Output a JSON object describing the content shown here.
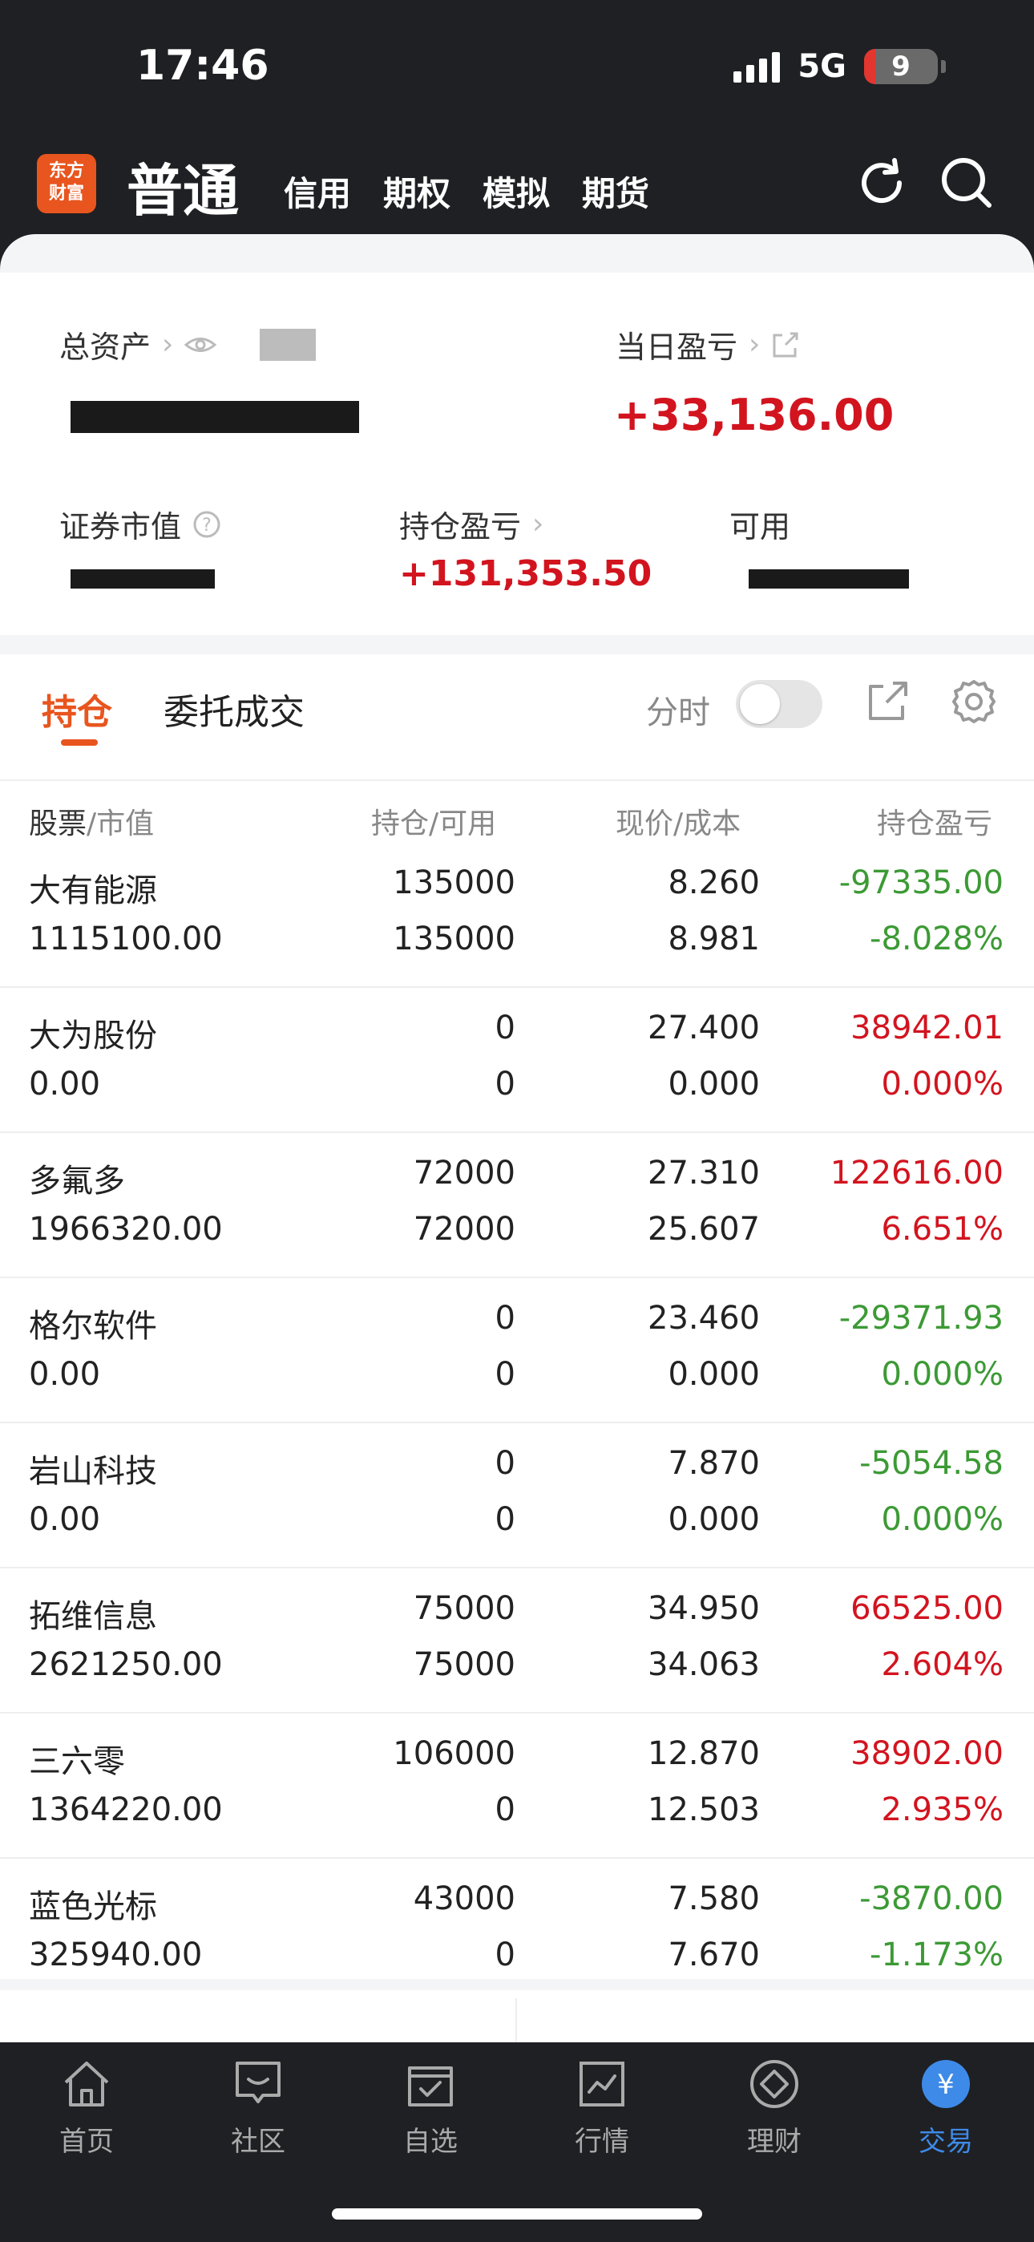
{
  "status": {
    "time": "17:46",
    "network": "5G",
    "battery": "9"
  },
  "header": {
    "logo_line1": "东方",
    "logo_line2": "财富",
    "main_tab": "普通",
    "tabs": [
      "信用",
      "期权",
      "模拟",
      "期货"
    ]
  },
  "summary": {
    "total_assets_label": "总资产",
    "daily_pl_label": "当日盈亏",
    "daily_pl_value": "+33,136.00",
    "market_value_label": "证券市值",
    "position_pl_label": "持仓盈亏",
    "position_pl_value": "+131,353.50",
    "available_label": "可用"
  },
  "positions": {
    "tab_active": "持仓",
    "tab_other": "委托成交",
    "fenshi_label": "分时",
    "columns": {
      "stock": "股票",
      "market_value": "/市值",
      "position": "持仓",
      "available": "/可用",
      "price": "现价",
      "cost": "/成本",
      "pl": "持仓盈亏"
    },
    "rows": [
      {
        "name": "大有能源",
        "value": "1115100.00",
        "position": "135000",
        "available": "135000",
        "price": "8.260",
        "cost": "8.981",
        "pl": "-97335.00",
        "pl_pct": "-8.028%",
        "trend": "down"
      },
      {
        "name": "大为股份",
        "value": "0.00",
        "position": "0",
        "available": "0",
        "price": "27.400",
        "cost": "0.000",
        "pl": "38942.01",
        "pl_pct": "0.000%",
        "trend": "up"
      },
      {
        "name": "多氟多",
        "value": "1966320.00",
        "position": "72000",
        "available": "72000",
        "price": "27.310",
        "cost": "25.607",
        "pl": "122616.00",
        "pl_pct": "6.651%",
        "trend": "up"
      },
      {
        "name": "格尔软件",
        "value": "0.00",
        "position": "0",
        "available": "0",
        "price": "23.460",
        "cost": "0.000",
        "pl": "-29371.93",
        "pl_pct": "0.000%",
        "trend": "down"
      },
      {
        "name": "岩山科技",
        "value": "0.00",
        "position": "0",
        "available": "0",
        "price": "7.870",
        "cost": "0.000",
        "pl": "-5054.58",
        "pl_pct": "0.000%",
        "trend": "down"
      },
      {
        "name": "拓维信息",
        "value": "2621250.00",
        "position": "75000",
        "available": "75000",
        "price": "34.950",
        "cost": "34.063",
        "pl": "66525.00",
        "pl_pct": "2.604%",
        "trend": "up"
      },
      {
        "name": "三六零",
        "value": "1364220.00",
        "position": "106000",
        "available": "0",
        "price": "12.870",
        "cost": "12.503",
        "pl": "38902.00",
        "pl_pct": "2.935%",
        "trend": "up"
      },
      {
        "name": "蓝色光标",
        "value": "325940.00",
        "position": "43000",
        "available": "0",
        "price": "7.580",
        "cost": "7.670",
        "pl": "-3870.00",
        "pl_pct": "-1.173%",
        "trend": "down"
      }
    ]
  },
  "bottom_nav": [
    {
      "label": "首页",
      "icon": "home-icon"
    },
    {
      "label": "社区",
      "icon": "community-icon"
    },
    {
      "label": "自选",
      "icon": "watchlist-icon"
    },
    {
      "label": "行情",
      "icon": "market-icon"
    },
    {
      "label": "理财",
      "icon": "wealth-icon"
    },
    {
      "label": "交易",
      "icon": "trade-icon",
      "active": true
    }
  ],
  "colors": {
    "accent": "#e8551e",
    "up": "#d2141f",
    "down": "#3c9a35",
    "nav_active": "#3e8ae8"
  }
}
